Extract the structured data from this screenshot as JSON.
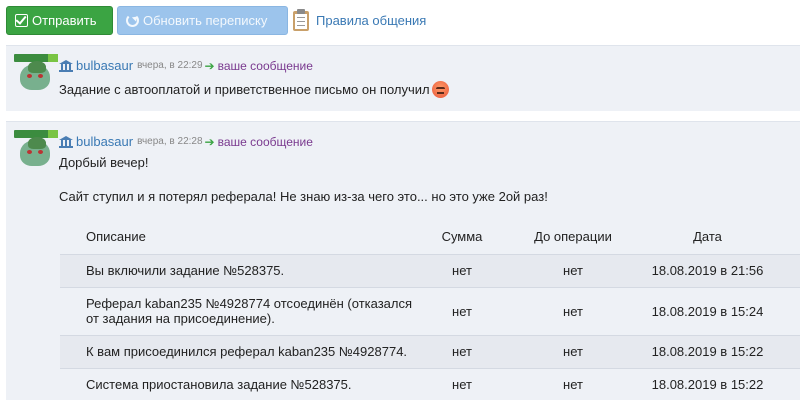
{
  "toolbar": {
    "send_label": "Отправить",
    "refresh_label": "Обновить переписку",
    "rules_label": "Правила общения"
  },
  "messages": [
    {
      "author": "bulbasaur",
      "time": "вчера, в 22:29",
      "direction": "ваше сообщение",
      "text": "Задание с автооплатой и приветственное письмо он получил"
    },
    {
      "author": "bulbasaur",
      "time": "вчера, в 22:28",
      "direction": "ваше сообщение",
      "line1": "Дорбый вечер!",
      "line2": "Сайт ступил и я потерял реферала! Не знаю из-за чего это... но это уже 2ой раз!"
    }
  ],
  "table": {
    "headers": [
      "Описание",
      "Сумма",
      "До операции",
      "Дата"
    ],
    "rows": [
      {
        "desc": "Вы включили задание №528375.",
        "sum": "нет",
        "before": "нет",
        "date": "18.08.2019 в 21:56"
      },
      {
        "desc_line1": "Реферал kaban235 №4928774 отсоединён (отказался",
        "desc_line2": "от задания на присоединение).",
        "sum": "нет",
        "before": "нет",
        "date": "18.08.2019 в 15:24"
      },
      {
        "desc": "К вам присоединился реферал kaban235 №4928774.",
        "sum": "нет",
        "before": "нет",
        "date": "18.08.2019 в 15:22"
      },
      {
        "desc": "Система приостановила задание №528375.",
        "sum": "нет",
        "before": "нет",
        "date": "18.08.2019 в 15:22"
      }
    ]
  },
  "colors": {
    "send_button": "#3ba443",
    "refresh_button": "#9cc4ec",
    "link": "#3a79b4",
    "your_message": "#7a3a8f",
    "message_bg": "#eef1f6"
  },
  "icons": [
    "check-icon",
    "refresh-icon",
    "clipboard-icon",
    "bank-icon",
    "arrow-right-icon",
    "angry-emoji-icon"
  ]
}
